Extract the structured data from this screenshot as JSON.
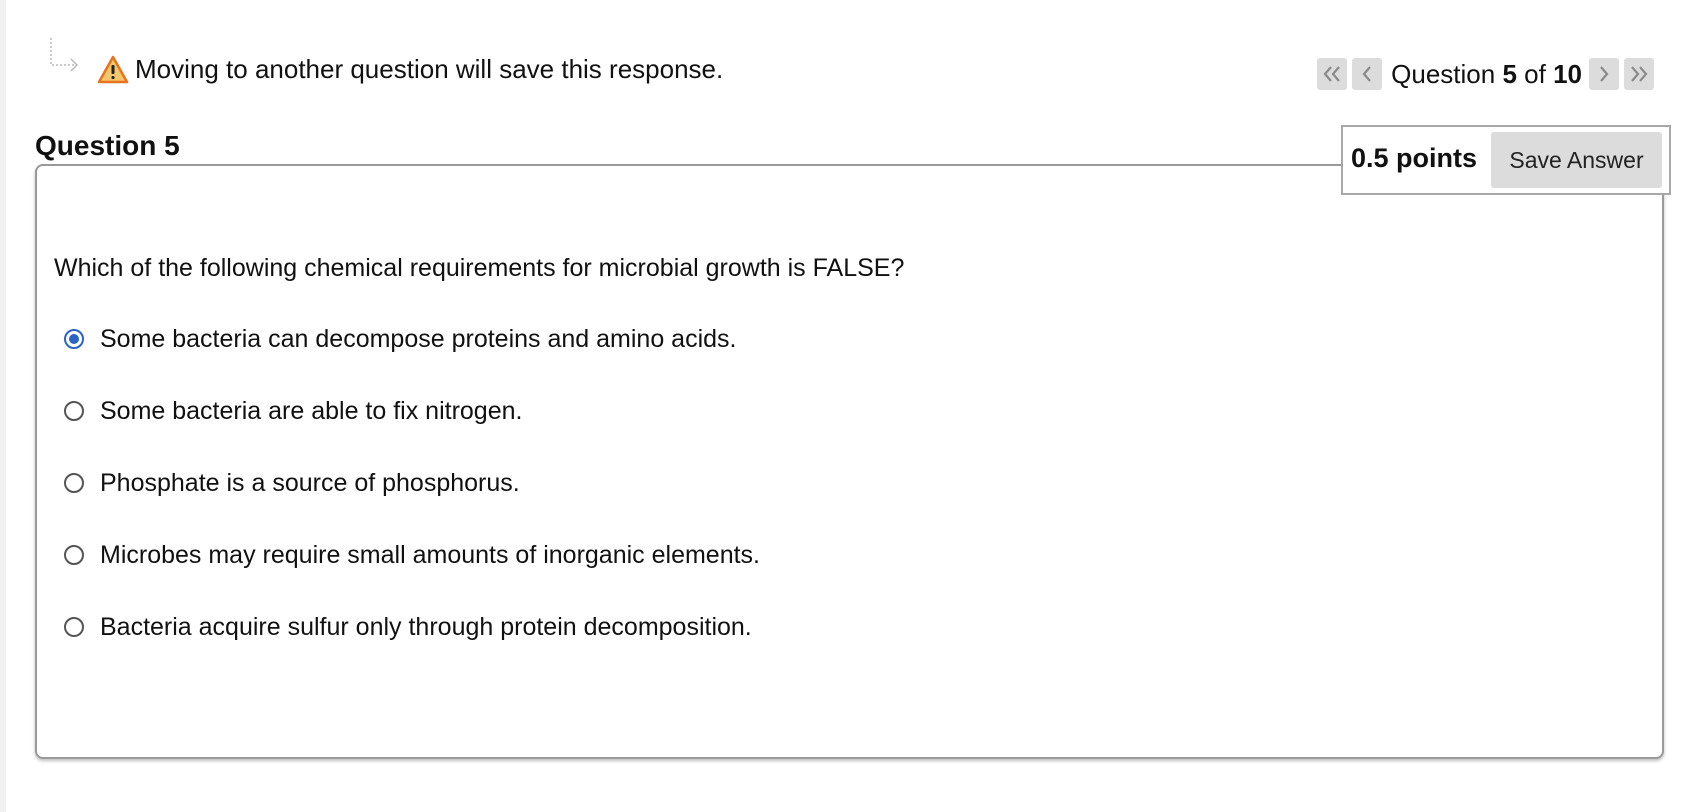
{
  "notice": {
    "text": "Moving to another question will save this response.",
    "icon": "warning-triangle-icon",
    "icon_color": "#f08a24"
  },
  "navigation": {
    "prefix": "Question",
    "current": "5",
    "separator": "of",
    "total": "10",
    "first_icon": "double-chevron-left-icon",
    "prev_icon": "chevron-left-icon",
    "next_icon": "chevron-right-icon",
    "last_icon": "double-chevron-right-icon"
  },
  "question": {
    "heading": "Question 5",
    "points": "0.5 points",
    "save_label": "Save Answer",
    "prompt": "Which of the following chemical requirements for microbial growth is FALSE?",
    "options": [
      {
        "label": "Some bacteria can decompose proteins and amino acids.",
        "selected": true
      },
      {
        "label": "Some bacteria are able to fix nitrogen.",
        "selected": false
      },
      {
        "label": "Phosphate is a source of phosphorus.",
        "selected": false
      },
      {
        "label": "Microbes may require small amounts of inorganic elements.",
        "selected": false
      },
      {
        "label": "Bacteria acquire sulfur only through protein decomposition.",
        "selected": false
      }
    ]
  },
  "colors": {
    "radio_selected": "#2a64c4",
    "nav_button_bg": "#dcdcdc",
    "box_border": "#9a9a9a"
  }
}
